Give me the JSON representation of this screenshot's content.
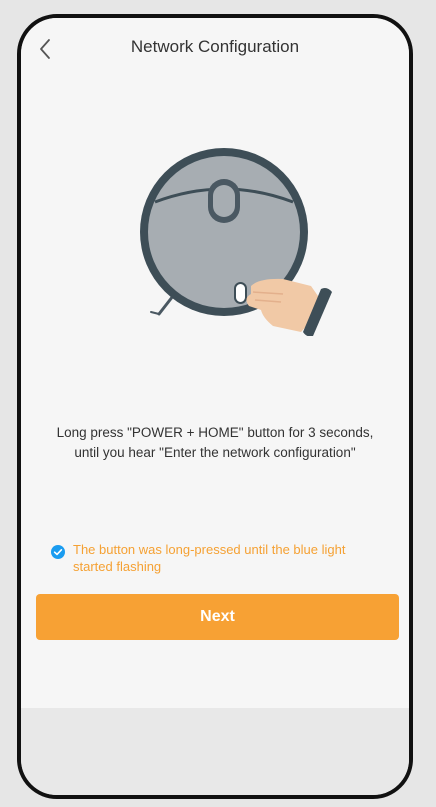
{
  "header": {
    "title": "Network Configuration",
    "back_icon": "chevron-left-icon"
  },
  "illustration": {
    "name": "robot-vacuum-illustration"
  },
  "instruction": {
    "line1": "Long press \"POWER + HOME\" button for 3 seconds,",
    "line2": "until you hear \"Enter the network configuration\""
  },
  "confirmation": {
    "text": "The button was long-pressed until the blue light started flashing",
    "checked": true,
    "check_color": "#1a9cf0",
    "text_color": "#f5a133"
  },
  "next_button": {
    "label": "Next",
    "color": "#f7a134"
  }
}
